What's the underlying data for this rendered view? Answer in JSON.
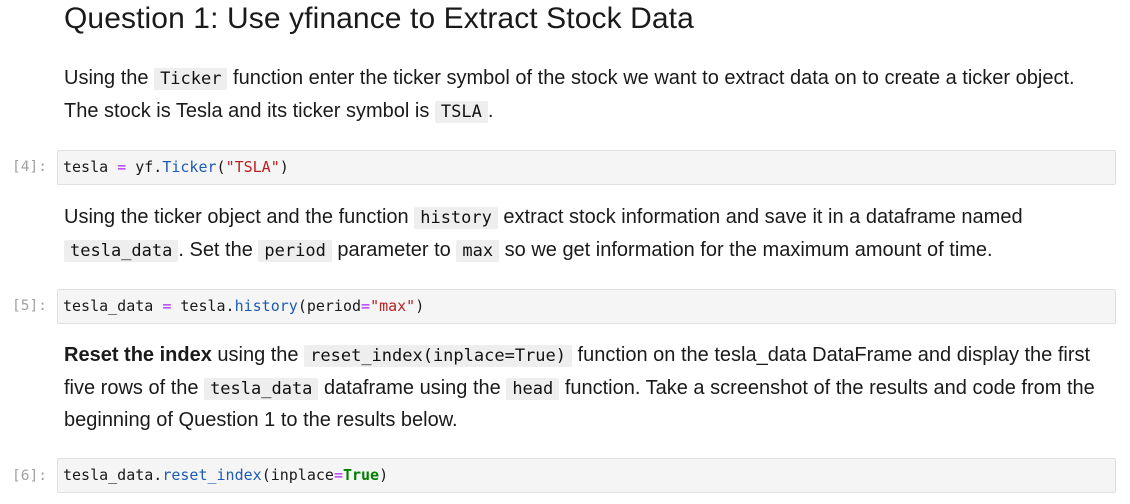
{
  "heading": "Question 1: Use yfinance to Extract Stock Data",
  "md1": {
    "t1": "Using the ",
    "c1": "Ticker",
    "t2": " function enter the ticker symbol of the stock we want to extract data on to create a ticker object. The stock is Tesla and its ticker symbol is ",
    "c2": "TSLA",
    "t3": "."
  },
  "cell1": {
    "prompt": "[4]:",
    "var": "tesla",
    "eq": "=",
    "obj": "yf.",
    "fn": "Ticker",
    "open": "(",
    "str": "\"TSLA\"",
    "close": ")"
  },
  "md2": {
    "t1": "Using the ticker object and the function ",
    "c1": "history",
    "t2": " extract stock information and save it in a dataframe named ",
    "c2": "tesla_data",
    "t3": ". Set the ",
    "c3": "period",
    "t4": " parameter to ",
    "c4": "max",
    "t5": " so we get information for the maximum amount of time."
  },
  "cell2": {
    "prompt": "[5]:",
    "var": "tesla_data",
    "eq": "=",
    "obj": "tesla.",
    "fn": "history",
    "open": "(period",
    "eq2": "=",
    "str": "\"max\"",
    "close": ")"
  },
  "md3": {
    "b1": "Reset the index",
    "t1": " using the ",
    "c1": "reset_index(inplace=True)",
    "t2": " function on the tesla_data DataFrame and display the first five rows of the ",
    "c2": "tesla_data",
    "t3": " dataframe using the ",
    "c3": "head",
    "t4": " function. Take a screenshot of the results and code from the beginning of Question 1 to the results below."
  },
  "cell3": {
    "prompt": "[6]:",
    "obj": "tesla_data.",
    "fn": "reset_index",
    "open": "(inplace",
    "eq": "=",
    "kw": "True",
    "close": ")"
  },
  "colors": {
    "operator": "#aa22ff",
    "function": "#1e5cb3",
    "string": "#ba2121",
    "keyword": "#008000",
    "prompt": "#a0a0a0",
    "cell_background": "#f5f5f5"
  }
}
